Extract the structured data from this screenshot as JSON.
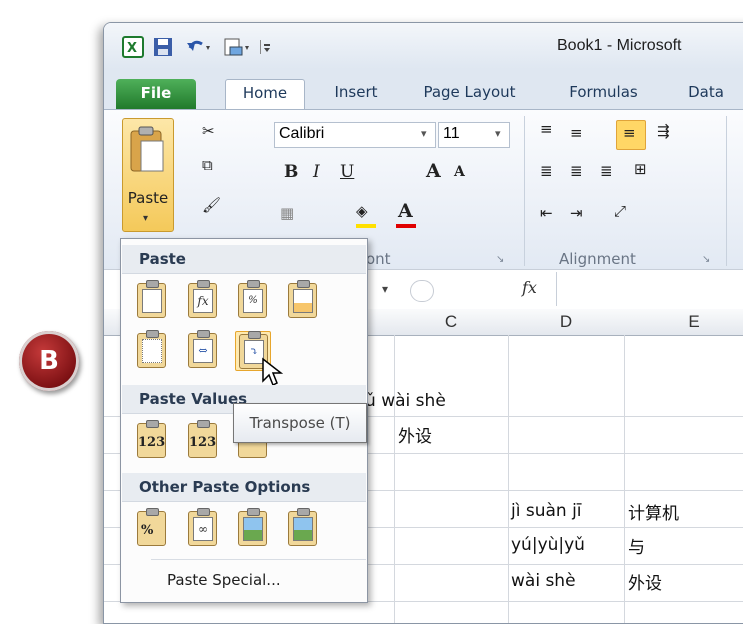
{
  "window": {
    "title": "Book1 - Microsoft"
  },
  "quick_access": {
    "excel_icon": "excel-icon",
    "save_icon": "save-icon",
    "undo_icon": "undo-icon",
    "print_icon": "print-icon",
    "customize_icon": "customize-icon"
  },
  "tabs": [
    {
      "label": "File"
    },
    {
      "label": "Home"
    },
    {
      "label": "Insert"
    },
    {
      "label": "Page Layout"
    },
    {
      "label": "Formulas"
    },
    {
      "label": "Data"
    }
  ],
  "ribbon": {
    "paste_label": "Paste",
    "font_name": "Calibri",
    "font_size": "11",
    "bold": "B",
    "italic": "I",
    "underline": "U",
    "font_group_label": "ont",
    "alignment_group_label": "Alignment"
  },
  "formula_bar": {
    "fx": "fx"
  },
  "columns": [
    "C",
    "D",
    "E"
  ],
  "cells": {
    "c1": "yǔ wài shè",
    "c2": "外设",
    "d4": "jì suàn jī",
    "e4": "计算机",
    "d5": "yú|yù|yǔ",
    "e5": "与",
    "d6": "wài shè",
    "e6": "外设"
  },
  "paste_menu": {
    "section_paste": "Paste",
    "section_values": "Paste Values",
    "section_other": "Other Paste Options",
    "paste_special": "Paste Special...",
    "icons_row1": [
      "paste-icon",
      "formulas-icon",
      "formulas-number-format-icon",
      "keep-source-formatting-icon"
    ],
    "icons_row2": [
      "no-borders-icon",
      "keep-column-widths-icon",
      "transpose-icon"
    ],
    "values_icons": [
      "values-icon",
      "values-number-format-icon",
      "values-source-formatting-icon"
    ],
    "other_icons": [
      "formatting-icon",
      "paste-link-icon",
      "picture-icon",
      "linked-picture-icon"
    ],
    "glyph_fx": "fx",
    "glyph_123": "123"
  },
  "tooltip": "Transpose (T)",
  "badge": "B",
  "colors": {
    "file_tab": "#217a2c",
    "badge": "#8b1a1c",
    "arrow": "#8b1a1a",
    "highlight": "#ffeab0"
  }
}
